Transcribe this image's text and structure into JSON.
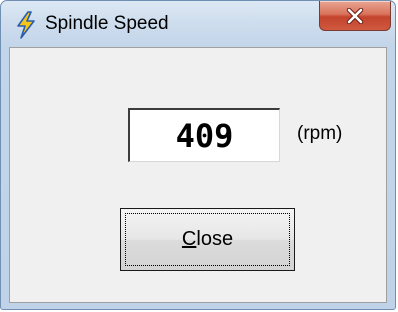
{
  "window": {
    "title": "Spindle Speed",
    "title_icon": "lightning-bolt-icon",
    "close_icon": "close-icon"
  },
  "speed": {
    "value": "409",
    "unit": "(rpm)"
  },
  "close_button": {
    "mnemonic": "C",
    "rest": "lose"
  },
  "colors": {
    "close_button_red": "#c4432c",
    "title_icon_yellow": "#f5c518",
    "title_icon_blue": "#2a5db0"
  }
}
